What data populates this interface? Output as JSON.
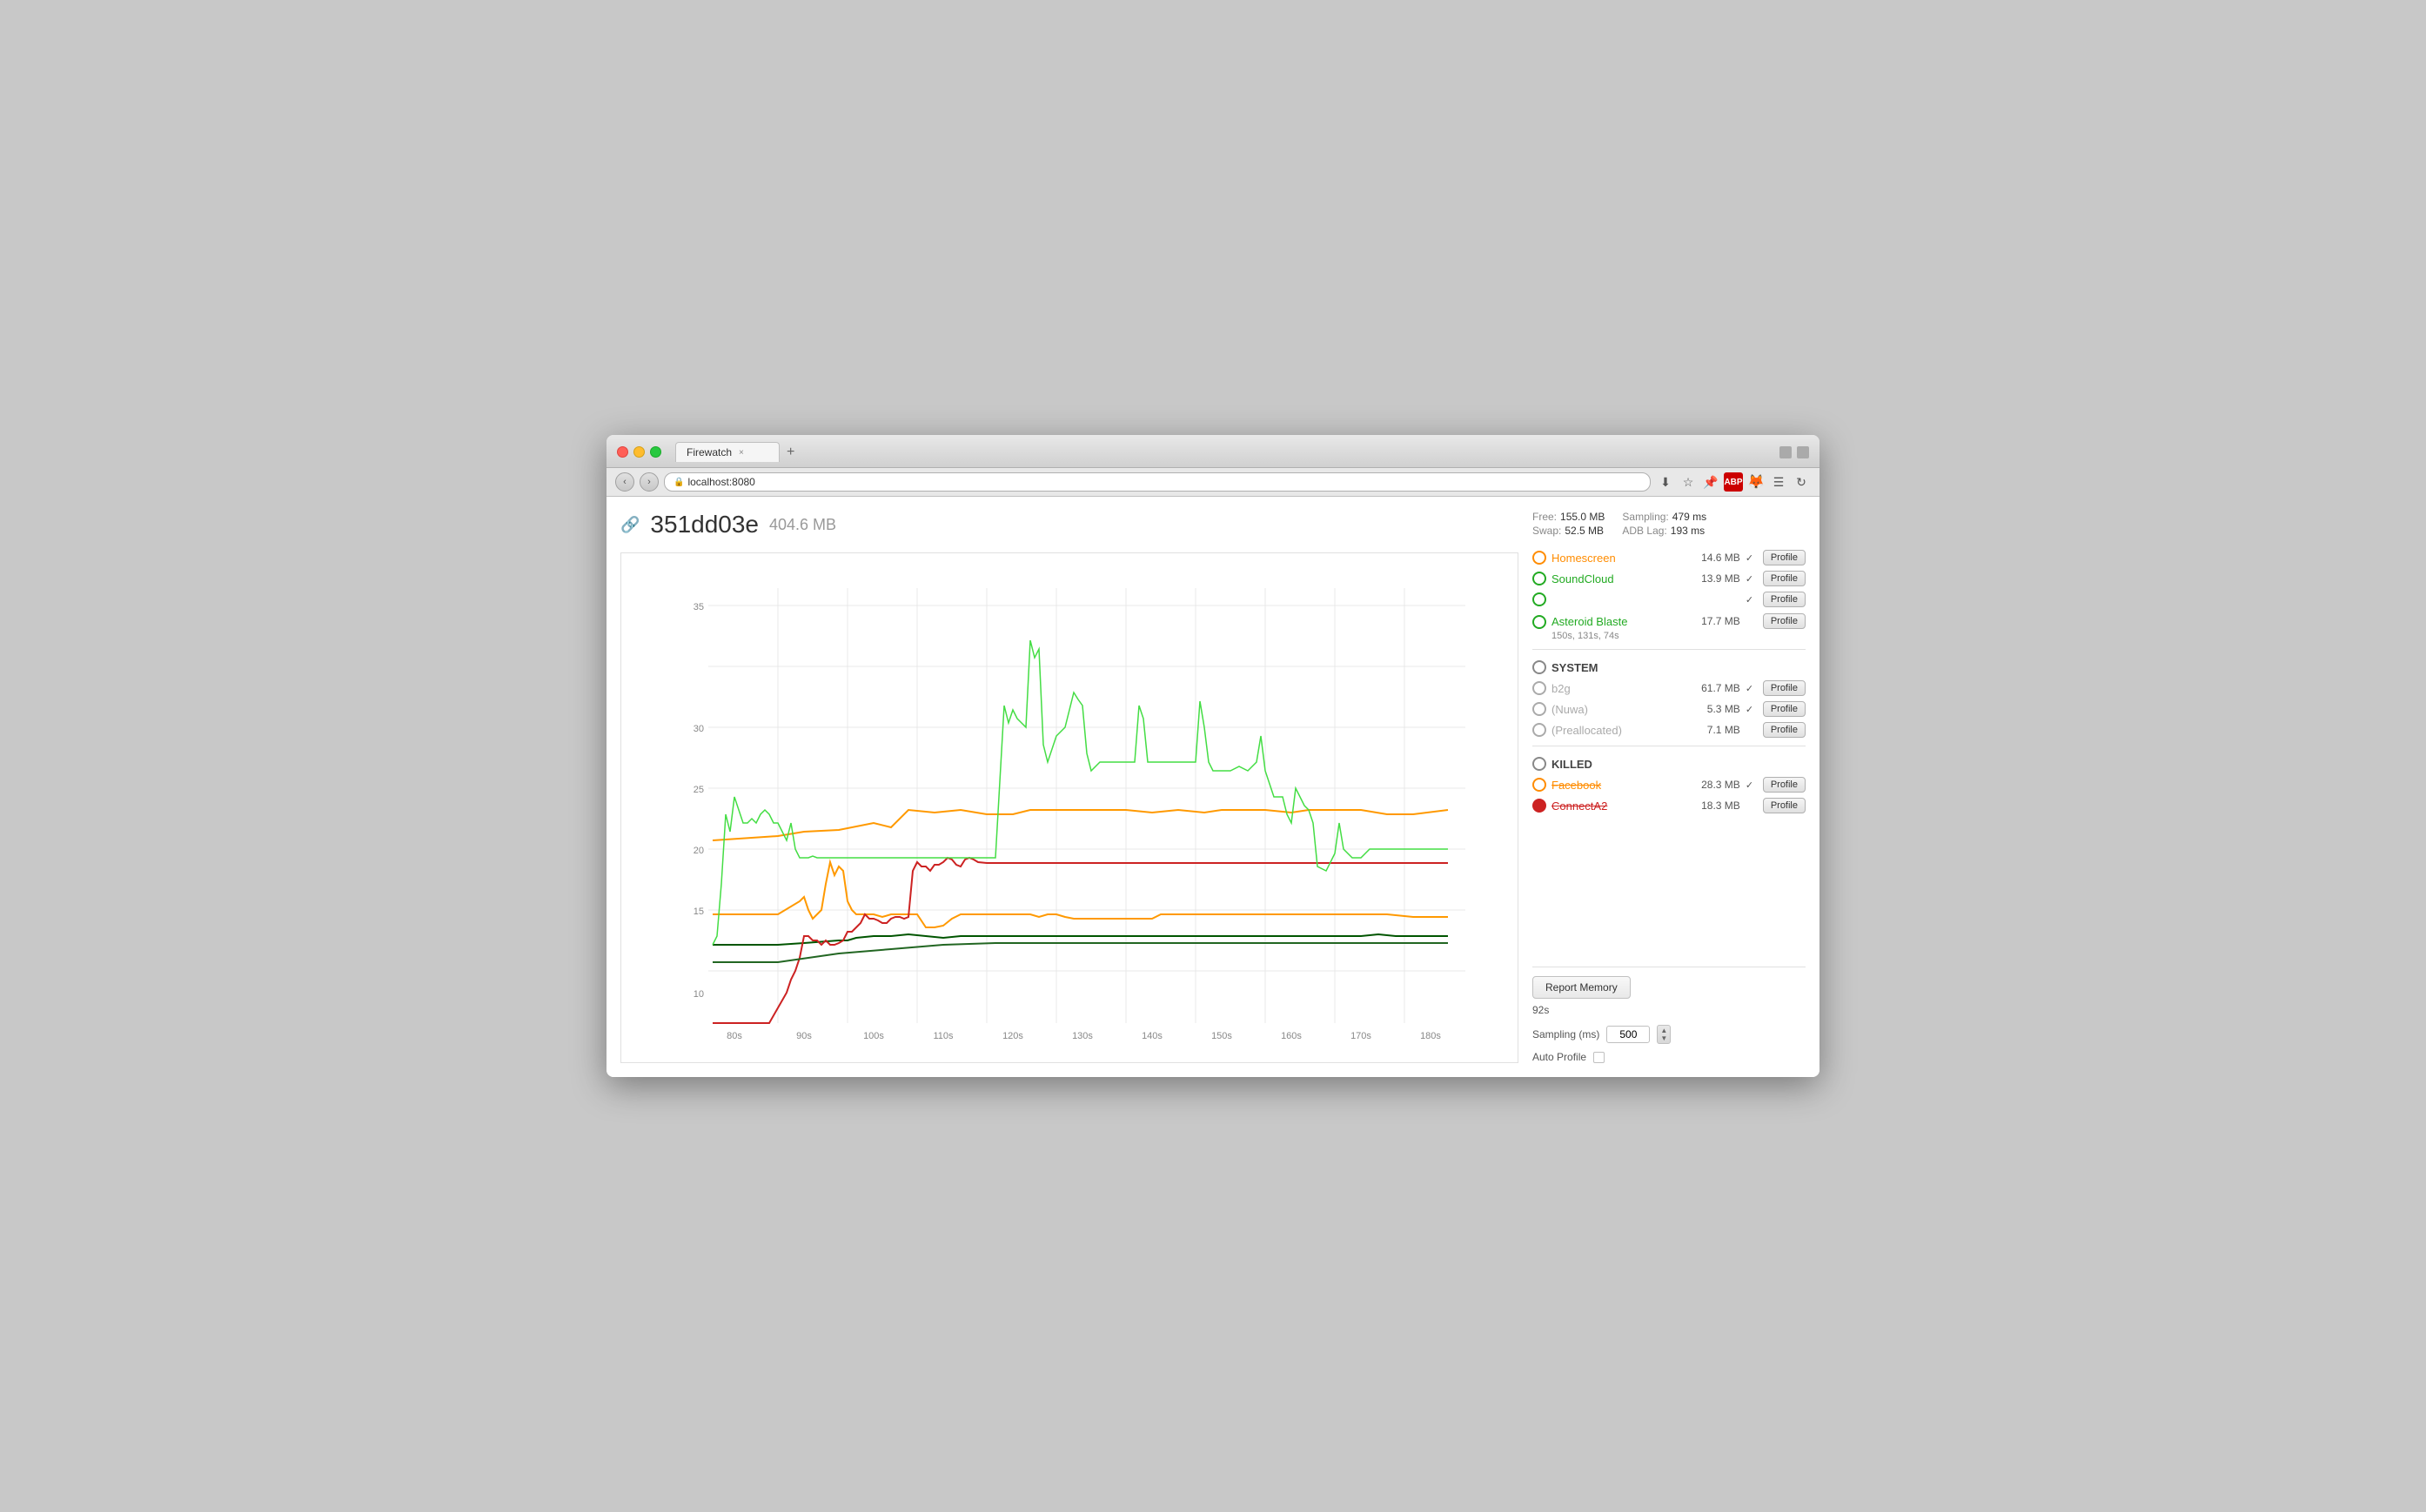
{
  "browser": {
    "tab_title": "Firewatch",
    "tab_close": "×",
    "tab_new": "+",
    "address": "localhost:8080",
    "back_btn": "‹",
    "forward_btn": "›",
    "refresh_btn": "↻"
  },
  "header": {
    "link_icon": "🔗",
    "app_id": "351dd03e",
    "memory": "404.6 MB"
  },
  "stats": {
    "free_label": "Free:",
    "free_value": "155.0 MB",
    "swap_label": "Swap:",
    "swap_value": "52.5 MB",
    "sampling_label": "Sampling:",
    "sampling_value": "479 ms",
    "adb_lag_label": "ADB Lag:",
    "adb_lag_value": "193 ms"
  },
  "chart": {
    "y_labels": [
      "10",
      "15",
      "20",
      "25",
      "30",
      "35"
    ],
    "x_labels": [
      "80s",
      "90s",
      "100s",
      "110s",
      "120s",
      "130s",
      "140s",
      "150s",
      "160s",
      "170s",
      "180s"
    ]
  },
  "processes": {
    "active": [
      {
        "name": "Homescreen",
        "color": "orange",
        "icon_style": "orange",
        "memory": "14.6 MB",
        "checked": true,
        "profile_label": "Profile"
      },
      {
        "name": "SoundCloud",
        "color": "green",
        "icon_style": "green",
        "memory": "13.9 MB",
        "checked": true,
        "profile_label": "Profile"
      },
      {
        "name": "",
        "color": "green",
        "icon_style": "green",
        "memory": "",
        "checked": true,
        "profile_label": "Profile"
      },
      {
        "name": "Asteroid Blaste",
        "color": "green",
        "icon_style": "green",
        "memory": "17.7 MB",
        "checked": false,
        "profile_label": "Profile",
        "times": "150s, 131s, 74s"
      }
    ],
    "system_header": "SYSTEM",
    "system": [
      {
        "name": "b2g",
        "color": "gray",
        "icon_style": "gray",
        "memory": "61.7 MB",
        "checked": true,
        "profile_label": "Profile"
      },
      {
        "name": "(Nuwa)",
        "color": "gray",
        "icon_style": "gray",
        "memory": "5.3 MB",
        "checked": true,
        "profile_label": "Profile"
      },
      {
        "name": "(Preallocated)",
        "color": "gray",
        "icon_style": "gray",
        "memory": "7.1 MB",
        "checked": false,
        "profile_label": "Profile"
      }
    ],
    "killed_header": "KILLED",
    "killed": [
      {
        "name": "Facebook",
        "color": "killed_orange",
        "icon_style": "orange",
        "memory": "28.3 MB",
        "checked": true,
        "profile_label": "Profile"
      },
      {
        "name": "ConnectA2",
        "color": "killed_red",
        "icon_style": "red",
        "memory": "18.3 MB",
        "checked": false,
        "profile_label": "Profile"
      }
    ]
  },
  "bottom": {
    "report_btn": "Report Memory",
    "time": "92s",
    "sampling_label": "Sampling (ms)",
    "sampling_value": "500",
    "auto_profile_label": "Auto Profile"
  }
}
